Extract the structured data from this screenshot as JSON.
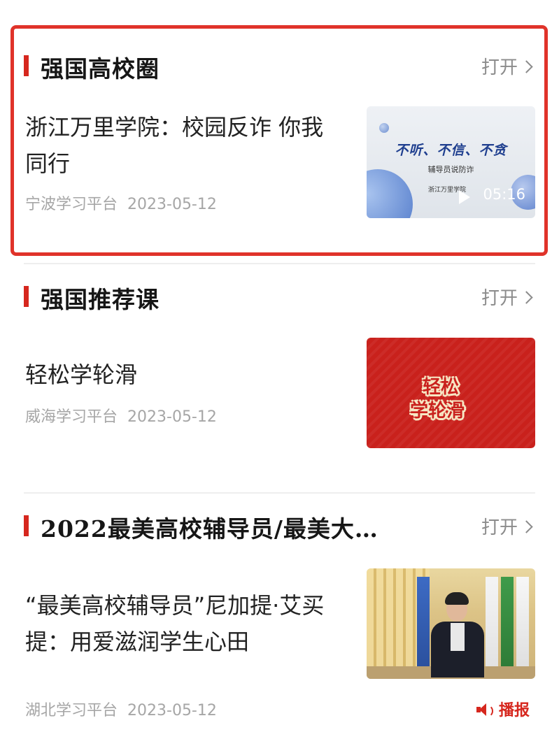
{
  "sections": [
    {
      "title": "强国高校圈",
      "open_label": "打开",
      "item": {
        "title": "浙江万里学院：校园反诈  你我同行",
        "source": "宁波学习平台",
        "date": "2023-05-12",
        "thumbnail": {
          "headline": "不听、不信、不贪",
          "subtitle": "辅导员说防诈",
          "school": "浙江万里学院",
          "duration": "05:16"
        }
      }
    },
    {
      "title": "强国推荐课",
      "open_label": "打开",
      "item": {
        "title": "轻松学轮滑",
        "source": "威海学习平台",
        "date": "2023-05-12",
        "thumbnail": {
          "line1": "轻松",
          "line2": "学轮滑"
        }
      }
    },
    {
      "title": "2022最美高校辅导员/最美大…",
      "open_label": "打开",
      "item": {
        "title": "“最美高校辅导员”尼加提·艾买提：用爱滋润学生心田",
        "source": "湖北学习平台",
        "date": "2023-05-12",
        "broadcast_label": "播报"
      }
    }
  ],
  "colors": {
    "accent": "#d6271e",
    "highlight_border": "#e0332a",
    "meta_text": "#a6a6a6",
    "link_text": "#8c8c8c"
  },
  "icons": [
    "chevron-right-icon",
    "play-icon",
    "speaker-icon"
  ]
}
